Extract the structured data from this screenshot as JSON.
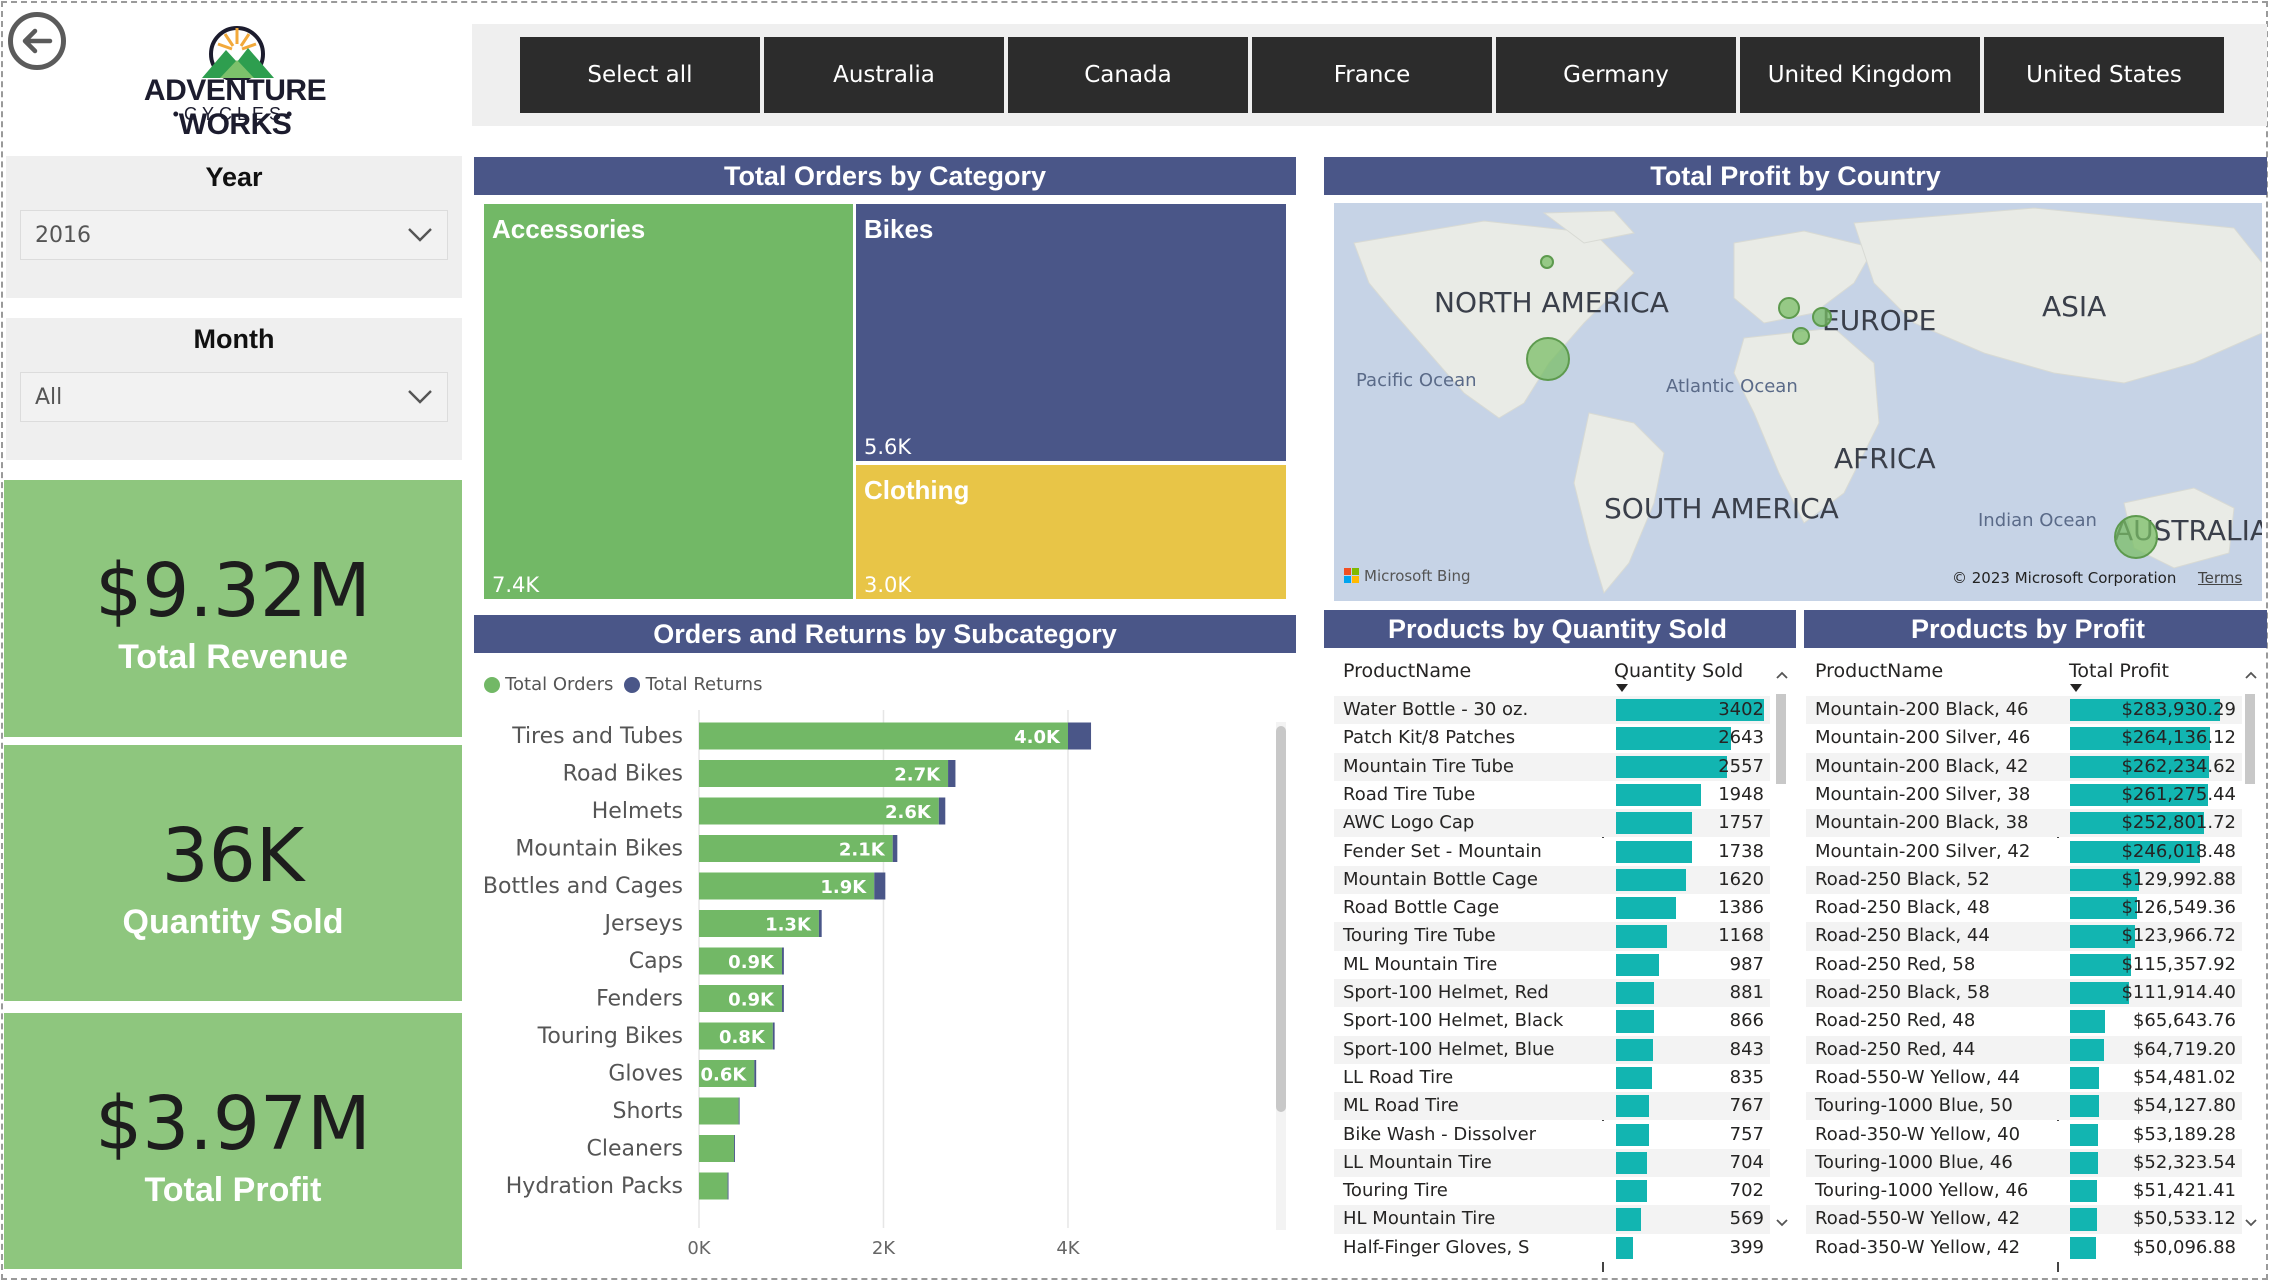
{
  "brand": {
    "name": "ADVENTURE WORKS",
    "sub": "CYCLES"
  },
  "countries": [
    "Select all",
    "Australia",
    "Canada",
    "France",
    "Germany",
    "United Kingdom",
    "United States"
  ],
  "filters": {
    "year": {
      "title": "Year",
      "value": "2016"
    },
    "month": {
      "title": "Month",
      "value": "All"
    }
  },
  "kpis": [
    {
      "value": "$9.32M",
      "label": "Total Revenue"
    },
    {
      "value": "36K",
      "label": "Quantity Sold"
    },
    {
      "value": "$3.97M",
      "label": "Total Profit"
    }
  ],
  "treemap": {
    "title": "Total Orders by Category",
    "items": [
      {
        "name": "Accessories",
        "value": "7.4K",
        "color": "#72b866"
      },
      {
        "name": "Bikes",
        "value": "5.6K",
        "color": "#4a5688"
      },
      {
        "name": "Clothing",
        "value": "3.0K",
        "color": "#e8c547"
      }
    ]
  },
  "map": {
    "title": "Total Profit by Country",
    "labels": {
      "north_america": "NORTH AMERICA",
      "europe": "EUROPE",
      "asia": "ASIA",
      "africa": "AFRICA",
      "south_america": "SOUTH AMERICA",
      "australia": "AUSTRALIA"
    },
    "oceans": {
      "pacific": "Pacific Ocean",
      "atlantic": "Atlantic Ocean",
      "indian": "Indian Ocean"
    },
    "attribution": {
      "bing": "Microsoft Bing",
      "copyright": "© 2023 Microsoft Corporation",
      "terms": "Terms"
    }
  },
  "subcategory_chart": {
    "title": "Orders and Returns by Subcategory",
    "legend": [
      "Total Orders",
      "Total Returns"
    ],
    "colors": {
      "orders": "#72b866",
      "returns": "#4a5688"
    },
    "x_ticks": [
      "0K",
      "2K",
      "4K"
    ]
  },
  "chart_data": {
    "type": "bar",
    "title": "Orders and Returns by Subcategory",
    "orientation": "horizontal",
    "stacked": true,
    "categories": [
      "Tires and Tubes",
      "Road Bikes",
      "Helmets",
      "Mountain Bikes",
      "Bottles and Cages",
      "Jerseys",
      "Caps",
      "Fenders",
      "Touring Bikes",
      "Gloves",
      "Shorts",
      "Cleaners",
      "Hydration Packs"
    ],
    "series": [
      {
        "name": "Total Orders",
        "values": [
          4000,
          2700,
          2600,
          2100,
          1900,
          1300,
          900,
          900,
          800,
          600,
          430,
          380,
          310
        ],
        "labels": [
          "4.0K",
          "2.7K",
          "2.6K",
          "2.1K",
          "1.9K",
          "1.3K",
          "0.9K",
          "0.9K",
          "0.8K",
          "0.6K",
          "",
          "",
          ""
        ]
      },
      {
        "name": "Total Returns",
        "values": [
          250,
          80,
          70,
          50,
          120,
          30,
          20,
          20,
          20,
          20,
          10,
          10,
          10
        ]
      }
    ],
    "xlim": [
      0,
      4900
    ],
    "xticks": [
      0,
      2000,
      4000
    ],
    "legend_position": "top-left",
    "grid": true
  },
  "qty_table": {
    "title": "Products by Quantity Sold",
    "columns": [
      "ProductName",
      "Quantity Sold"
    ],
    "bar_color": "#12b5b1",
    "max": 3402,
    "rows": [
      [
        "Water Bottle - 30 oz.",
        "3402",
        3402
      ],
      [
        "Patch Kit/8 Patches",
        "2643",
        2643
      ],
      [
        "Mountain Tire Tube",
        "2557",
        2557
      ],
      [
        "Road Tire Tube",
        "1948",
        1948
      ],
      [
        "AWC Logo Cap",
        "1757",
        1757
      ],
      [
        "Fender Set - Mountain",
        "1738",
        1738
      ],
      [
        "Mountain Bottle Cage",
        "1620",
        1620
      ],
      [
        "Road Bottle Cage",
        "1386",
        1386
      ],
      [
        "Touring Tire Tube",
        "1168",
        1168
      ],
      [
        "ML Mountain Tire",
        "987",
        987
      ],
      [
        "Sport-100 Helmet, Red",
        "881",
        881
      ],
      [
        "Sport-100 Helmet, Black",
        "866",
        866
      ],
      [
        "Sport-100 Helmet, Blue",
        "843",
        843
      ],
      [
        "LL Road Tire",
        "835",
        835
      ],
      [
        "ML Road Tire",
        "767",
        767
      ],
      [
        "Bike Wash - Dissolver",
        "757",
        757
      ],
      [
        "LL Mountain Tire",
        "704",
        704
      ],
      [
        "Touring Tire",
        "702",
        702
      ],
      [
        "HL Mountain Tire",
        "569",
        569
      ],
      [
        "Half-Finger Gloves, S",
        "399",
        399
      ]
    ]
  },
  "profit_table": {
    "title": "Products by Profit",
    "columns": [
      "ProductName",
      "Total Profit"
    ],
    "bar_color": "#12b5b1",
    "max": 283930.29,
    "rows": [
      [
        "Mountain-200 Black, 46",
        "$283,930.29",
        283930.29
      ],
      [
        "Mountain-200 Silver, 46",
        "$264,136.12",
        264136.12
      ],
      [
        "Mountain-200 Black, 42",
        "$262,234.62",
        262234.62
      ],
      [
        "Mountain-200 Silver, 38",
        "$261,275.44",
        261275.44
      ],
      [
        "Mountain-200 Black, 38",
        "$252,801.72",
        252801.72
      ],
      [
        "Mountain-200 Silver, 42",
        "$246,018.48",
        246018.48
      ],
      [
        "Road-250 Black, 52",
        "$129,992.88",
        129992.88
      ],
      [
        "Road-250 Black, 48",
        "$126,549.36",
        126549.36
      ],
      [
        "Road-250 Black, 44",
        "$123,966.72",
        123966.72
      ],
      [
        "Road-250 Red, 58",
        "$115,357.92",
        115357.92
      ],
      [
        "Road-250 Black, 58",
        "$111,914.40",
        111914.4
      ],
      [
        "Road-250 Red, 48",
        "$65,643.76",
        65643.76
      ],
      [
        "Road-250 Red, 44",
        "$64,719.20",
        64719.2
      ],
      [
        "Road-550-W Yellow, 44",
        "$54,481.02",
        54481.02
      ],
      [
        "Touring-1000 Blue, 50",
        "$54,127.80",
        54127.8
      ],
      [
        "Road-350-W Yellow, 40",
        "$53,189.28",
        53189.28
      ],
      [
        "Touring-1000 Blue, 46",
        "$52,323.54",
        52323.54
      ],
      [
        "Touring-1000 Yellow, 46",
        "$51,421.41",
        51421.41
      ],
      [
        "Road-550-W Yellow, 42",
        "$50,533.12",
        50533.12
      ],
      [
        "Road-350-W Yellow, 42",
        "$50,096.88",
        50096.88
      ]
    ]
  }
}
